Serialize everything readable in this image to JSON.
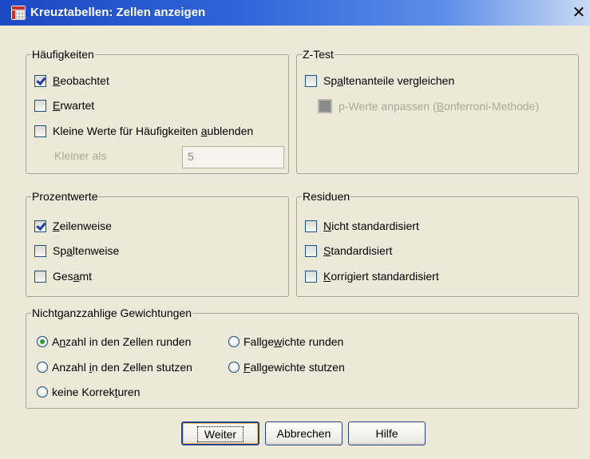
{
  "window": {
    "title": "Kreuztabellen: Zellen anzeigen",
    "close": "✕"
  },
  "haeufigkeiten": {
    "legend": "Häufigkeiten",
    "beobachtet": {
      "u": "B",
      "rest": "eobachtet",
      "checked": true
    },
    "erwartet": {
      "u": "E",
      "rest": "rwartet",
      "checked": false
    },
    "kleine": {
      "pre": "Kleine Werte für Häufigkeiten ",
      "u": "a",
      "rest": "ublenden",
      "checked": false
    },
    "kleiner_als_label": "Kleiner als",
    "kleiner_als_value": "5"
  },
  "ztest": {
    "legend": "Z-Test",
    "spalten": {
      "pre": "Sp",
      "u": "a",
      "rest": "ltenanteile vergleichen",
      "checked": false
    },
    "pwerte": {
      "pre": "p-Werte anpassen (",
      "u": "B",
      "rest": "onferroni-Methode)",
      "checked": false,
      "enabled": false
    }
  },
  "prozentwerte": {
    "legend": "Prozentwerte",
    "zeilen": {
      "u": "Z",
      "rest": "eilenweise",
      "checked": true
    },
    "spalten": {
      "pre": "Sp",
      "u": "a",
      "rest": "ltenweise",
      "checked": false
    },
    "gesamt": {
      "pre": "Ges",
      "u": "a",
      "rest": "mt",
      "checked": false
    }
  },
  "residuen": {
    "legend": "Residuen",
    "nicht": {
      "u": "N",
      "rest": "icht standardisiert",
      "checked": false
    },
    "standard": {
      "u": "S",
      "rest": "tandardisiert",
      "checked": false
    },
    "korrigiert": {
      "u": "K",
      "rest": "orrigiert standardisiert",
      "checked": false
    }
  },
  "gewichtungen": {
    "legend": "Nichtganzzahlige Gewichtungen",
    "opt1": {
      "pre": "A",
      "u": "n",
      "rest": "zahl in den Zellen runden",
      "selected": true
    },
    "opt2": {
      "pre": "Fallge",
      "u": "w",
      "rest": "ichte runden",
      "selected": false
    },
    "opt3": {
      "pre": "Anzahl ",
      "u": "i",
      "rest": "n den Zellen stutzen",
      "selected": false
    },
    "opt4": {
      "pre": "",
      "u": "F",
      "rest": "allgewichte stutzen",
      "selected": false
    },
    "opt5": {
      "pre": "keine Korrek",
      "u": "t",
      "rest": "uren",
      "selected": false
    }
  },
  "buttons": {
    "weiter": "Weiter",
    "abbrechen": "Abbrechen",
    "hilfe": "Hilfe"
  }
}
